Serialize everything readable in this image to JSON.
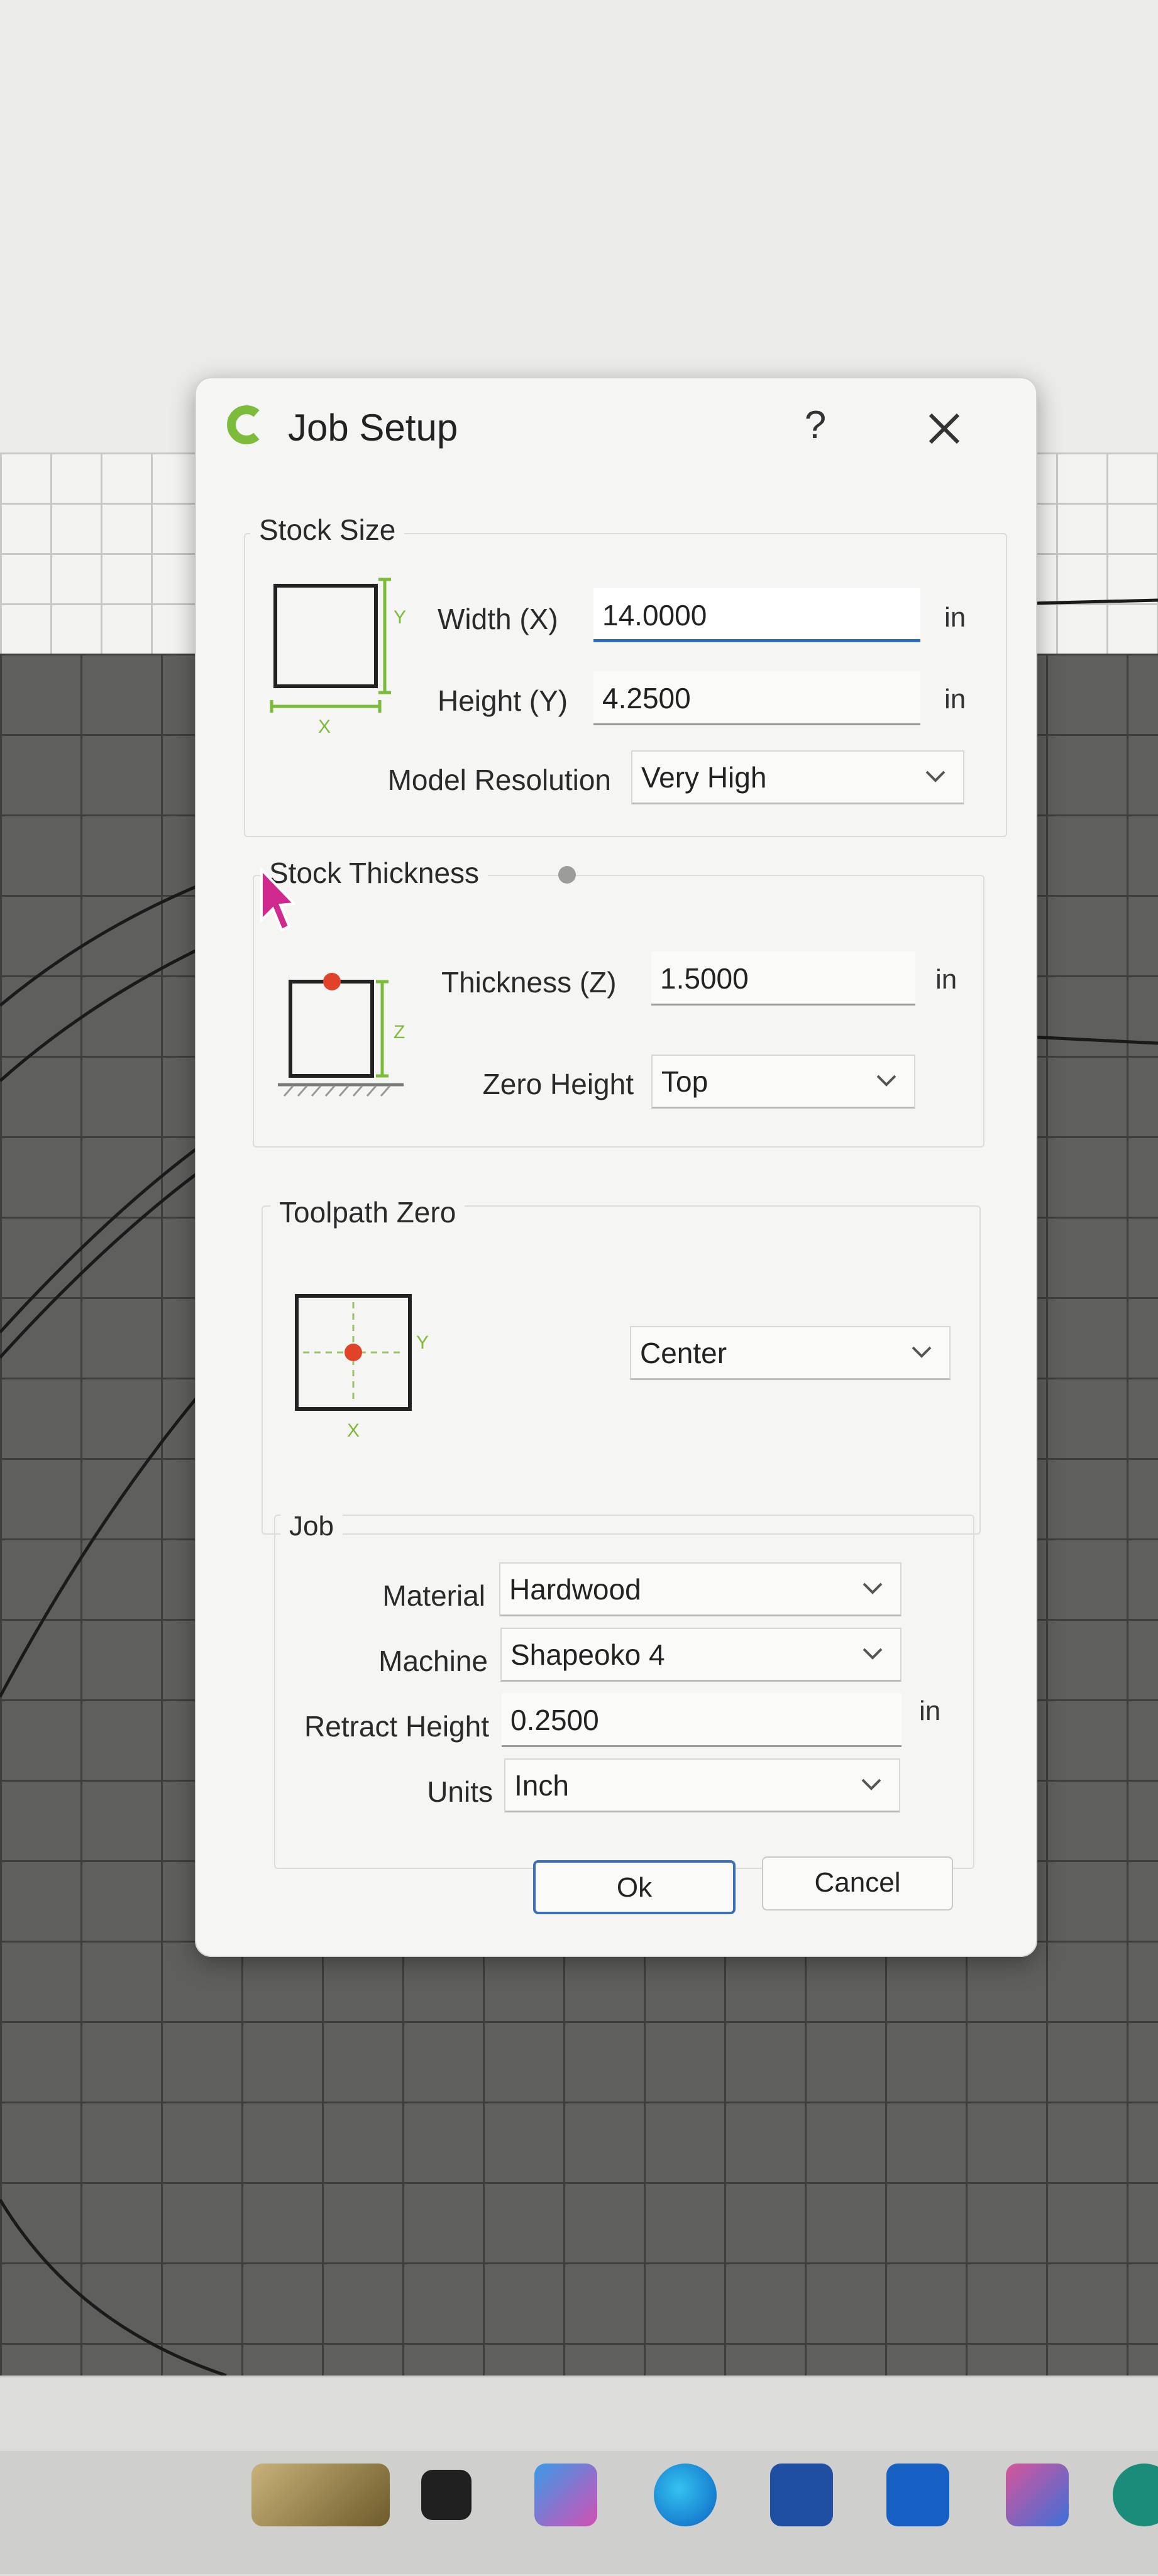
{
  "dialog": {
    "title": "Job Setup",
    "help_label": "?",
    "icons": {
      "logo": "carbide-logo-icon",
      "close": "close-icon",
      "help": "help-icon"
    }
  },
  "stock_size": {
    "label": "Stock Size",
    "diagram_axes": {
      "x": "X",
      "y": "Y"
    },
    "width_label": "Width (X)",
    "width_value": "14.0000",
    "width_unit": "in",
    "height_label": "Height (Y)",
    "height_value": "4.2500",
    "height_unit": "in",
    "resolution_label": "Model Resolution",
    "resolution_value": "Very High"
  },
  "stock_thickness": {
    "label": "Stock Thickness",
    "diagram_axis": "Z",
    "thickness_label": "Thickness (Z)",
    "thickness_value": "1.5000",
    "thickness_unit": "in",
    "zero_height_label": "Zero Height",
    "zero_height_value": "Top"
  },
  "toolpath_zero": {
    "label": "Toolpath Zero",
    "diagram_axes": {
      "x": "X",
      "y": "Y"
    },
    "value": "Center"
  },
  "job": {
    "label": "Job",
    "material_label": "Material",
    "material_value": "Hardwood",
    "machine_label": "Machine",
    "machine_value": "Shapeoko 4",
    "retract_label": "Retract Height",
    "retract_value": "0.2500",
    "retract_unit": "in",
    "units_label": "Units",
    "units_value": "Inch"
  },
  "buttons": {
    "ok": "Ok",
    "cancel": "Cancel"
  },
  "colors": {
    "accent": "#2f6cbf",
    "axis_green": "#7dbb3a",
    "origin_red": "#e0432a",
    "cursor_magenta": "#d12a8e"
  }
}
